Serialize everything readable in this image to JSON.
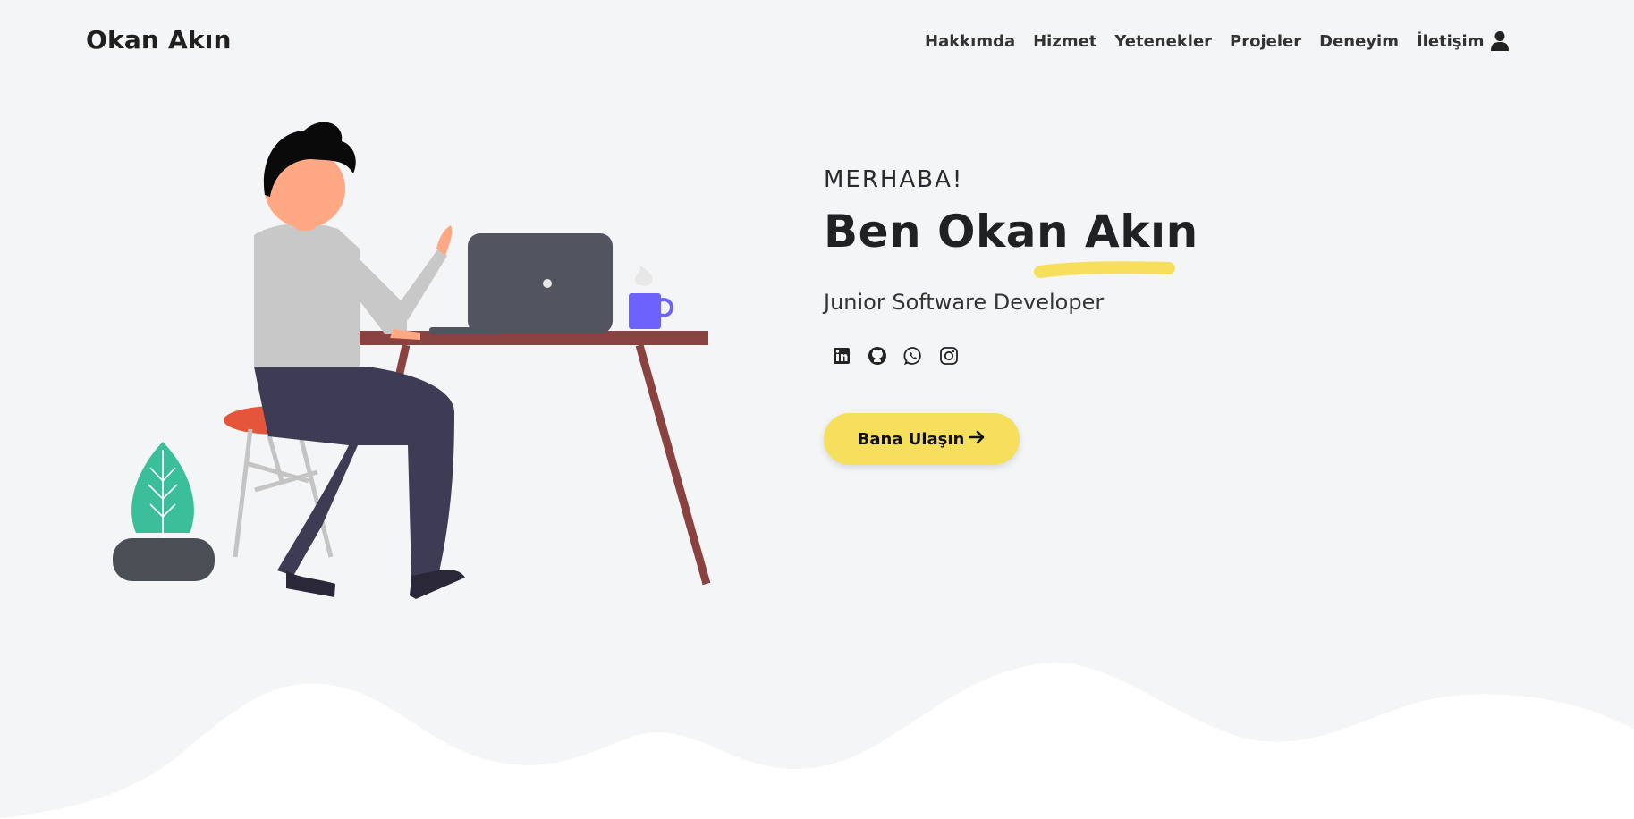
{
  "brand": "Okan Akın",
  "nav": {
    "links": [
      "Hakkımda",
      "Hizmet",
      "Yetenekler",
      "Projeler",
      "Deneyim",
      "İletişim"
    ]
  },
  "hero": {
    "greeting": "MERHABA!",
    "name": "Ben Okan Akın",
    "role": "Junior Software Developer",
    "cta_label": "Bana Ulaşın",
    "cta_icon": "→"
  },
  "socials": [
    "linkedin-icon",
    "github-icon",
    "whatsapp-icon",
    "instagram-icon"
  ],
  "colors": {
    "background": "#f4f5f7",
    "accent": "#f6df5d",
    "text": "#1f2125"
  }
}
